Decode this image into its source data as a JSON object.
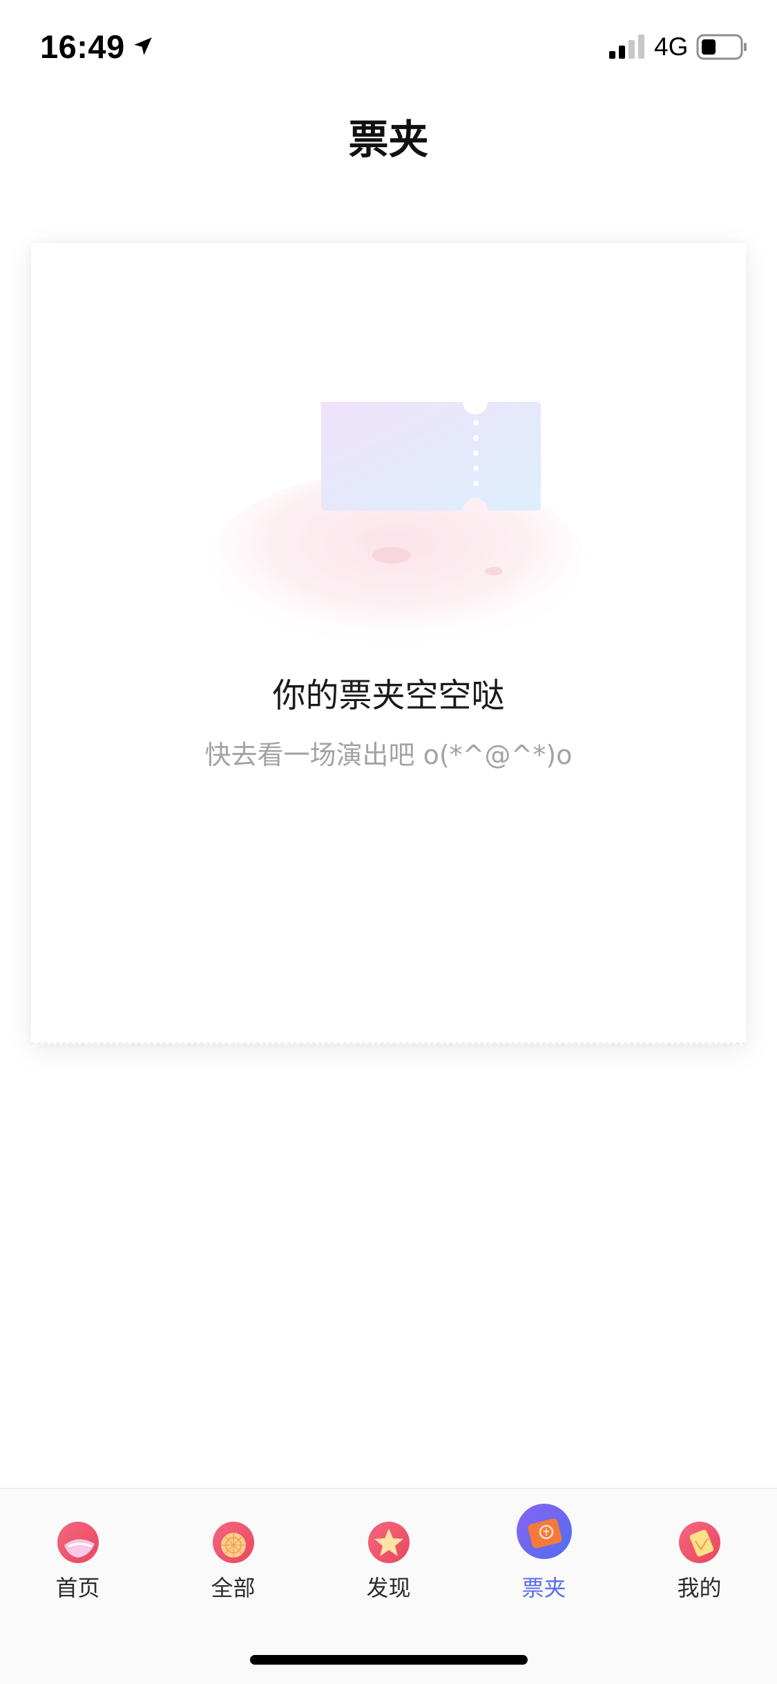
{
  "status_bar": {
    "time": "16:49",
    "network": "4G",
    "icons": [
      "location-arrow-icon",
      "signal-icon",
      "battery-icon"
    ]
  },
  "header": {
    "title": "票夹"
  },
  "empty_state": {
    "illustration": "empty-ticket-illustration",
    "title": "你的票夹空空哒",
    "subtitle": "快去看一场演出吧 o(*^@^*)o"
  },
  "tab_bar": {
    "active_index": 3,
    "active_color": "#5a6cf0",
    "items": [
      {
        "label": "首页",
        "icon": "home-icon"
      },
      {
        "label": "全部",
        "icon": "all-icon"
      },
      {
        "label": "发现",
        "icon": "discover-icon"
      },
      {
        "label": "票夹",
        "icon": "ticket-wallet-icon"
      },
      {
        "label": "我的",
        "icon": "profile-vip-icon"
      }
    ]
  }
}
